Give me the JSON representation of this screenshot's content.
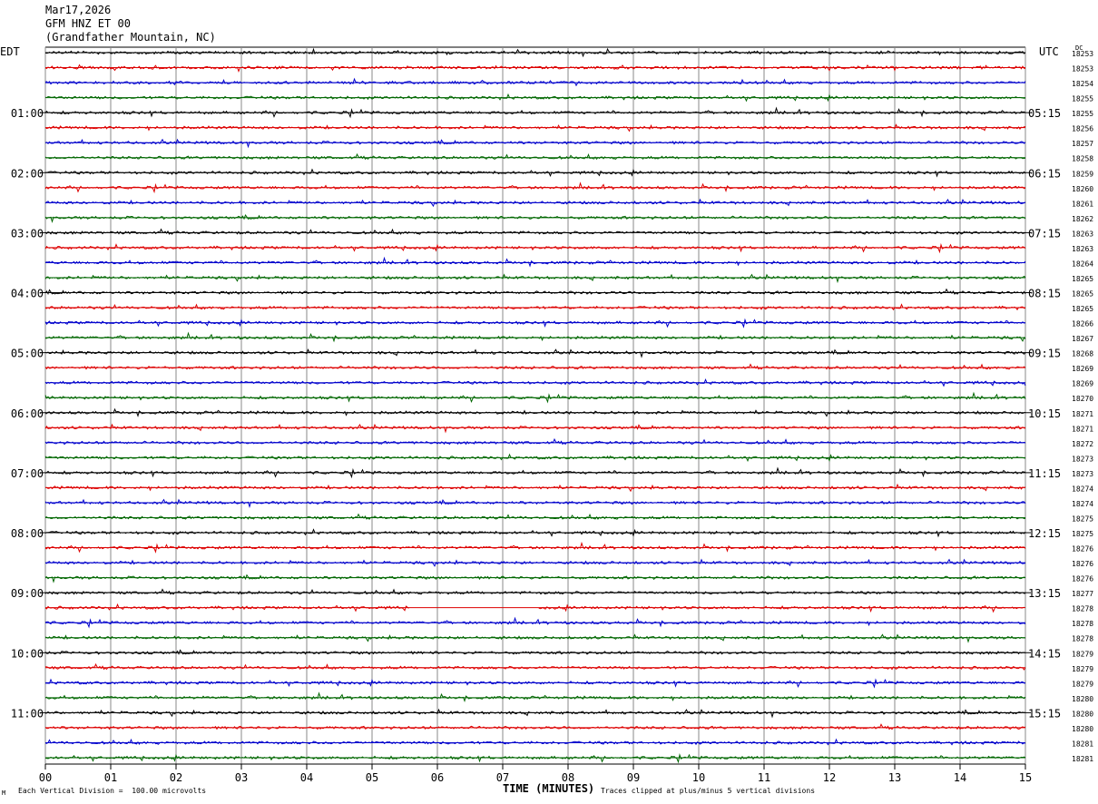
{
  "header": {
    "date": "Mar17,2026",
    "station": "GFM HNZ ET 00",
    "location": "(Grandfather Mountain, NC)"
  },
  "left_zone": "EDT",
  "right_zone": "UTC",
  "dc_label": "DC",
  "footer": {
    "scale": "Each Vertical Division =  100.00 microvolts",
    "clip": "Traces clipped at plus/minus 5 vertical divisions",
    "logo": "M"
  },
  "chart_data": {
    "type": "line",
    "title": "",
    "xlabel": "TIME (MINUTES)",
    "ylabel": "",
    "x_ticks": [
      "00",
      "01",
      "02",
      "03",
      "04",
      "05",
      "06",
      "07",
      "08",
      "09",
      "10",
      "11",
      "12",
      "13",
      "14",
      "15"
    ],
    "xlim": [
      0,
      15
    ],
    "grid": true,
    "trace_colors": [
      "#000000",
      "#dd0000",
      "#0000cc",
      "#006600"
    ],
    "left_time_labels": [
      "01:00",
      "02:00",
      "03:00",
      "04:00",
      "05:00",
      "06:00",
      "07:00",
      "08:00",
      "09:00",
      "10:00",
      "11:00"
    ],
    "right_time_labels": [
      "05:15",
      "06:15",
      "07:15",
      "08:15",
      "09:15",
      "10:15",
      "11:15",
      "12:15",
      "13:15",
      "14:15",
      "15:15"
    ],
    "dc_values": [
      "18253",
      "18253",
      "18254",
      "18255",
      "18255",
      "18256",
      "18257",
      "18258",
      "18259",
      "18260",
      "18261",
      "18262",
      "18263",
      "18263",
      "18264",
      "18265",
      "18265",
      "18265",
      "18266",
      "18267",
      "18268",
      "18269",
      "18269",
      "18270",
      "18271",
      "18271",
      "18272",
      "18273",
      "18273",
      "18274",
      "18274",
      "18275",
      "18275",
      "18276",
      "18276",
      "18276",
      "18277",
      "18278",
      "18278",
      "18278",
      "18279",
      "18279",
      "18279",
      "18280",
      "18280",
      "18280",
      "18281",
      "18281"
    ],
    "gap": {
      "trace_index": 37,
      "x_start": 5.58,
      "x_end": 7.55
    }
  }
}
